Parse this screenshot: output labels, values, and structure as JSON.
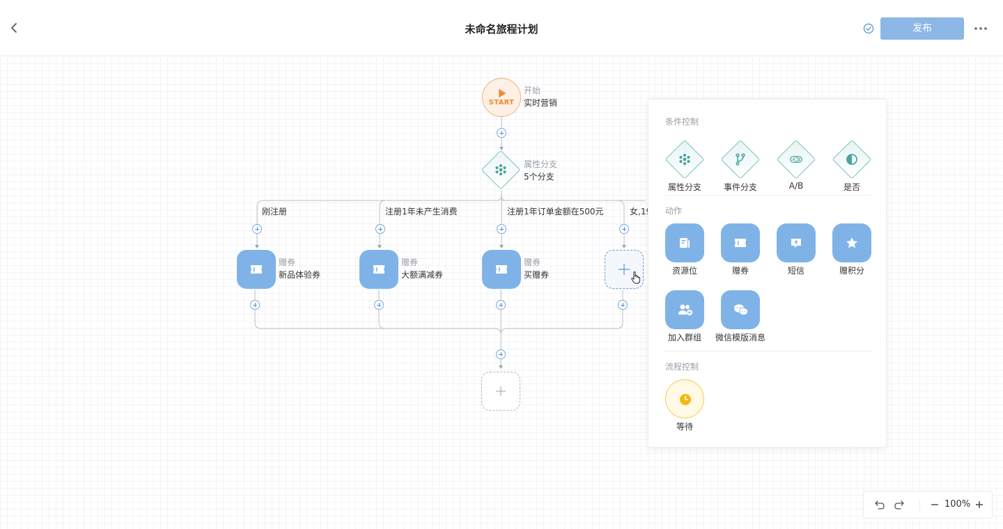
{
  "header": {
    "title": "未命名旅程计划",
    "publish_label": "发布"
  },
  "canvas": {
    "start_node": {
      "badge": "START",
      "subtitle": "开始",
      "name": "实时营销"
    },
    "split_node": {
      "subtitle": "属性分支",
      "name": "5个分支"
    },
    "branches": [
      {
        "label": "刚注册",
        "node_type": "赠券",
        "node_name": "新品体验券"
      },
      {
        "label": "注册1年未产生消费",
        "node_type": "赠券",
        "node_name": "大额满减券"
      },
      {
        "label": "注册1年订单金额在500元",
        "node_type": "赠券",
        "node_name": "买赠券"
      },
      {
        "label": "女,19"
      }
    ]
  },
  "panel": {
    "sections": [
      {
        "title": "条件控制",
        "items": [
          "属性分支",
          "事件分支",
          "A/B",
          "是否"
        ]
      },
      {
        "title": "动作",
        "items": [
          "资源位",
          "赠券",
          "短信",
          "赠积分",
          "加入群组",
          "微信模版消息"
        ]
      },
      {
        "title": "流程控制",
        "items": [
          "等待"
        ]
      }
    ]
  },
  "zoom": {
    "level": "100%"
  },
  "colors": {
    "primary": "#8db7e6",
    "action_node": "#7fb3e8",
    "condition_border": "#7dbdb8",
    "start_accent": "#ef8a34",
    "wait_accent": "#f2c94c"
  },
  "icons": {
    "back": "chevron-left-icon",
    "saved": "check-circle-icon",
    "more": "more-horizontal-icon",
    "undo": "undo-icon",
    "redo": "redo-icon",
    "zoom_out": "minus-icon",
    "zoom_in": "plus-icon"
  }
}
